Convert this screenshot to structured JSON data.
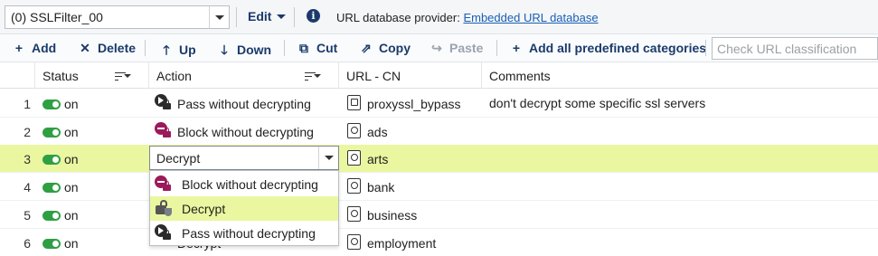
{
  "filter": {
    "selected": "(0) SSLFilter_00"
  },
  "menu": {
    "edit_label": "Edit"
  },
  "provider": {
    "label": "URL database provider:",
    "link": "Embedded URL database"
  },
  "toolbar": {
    "add": "Add",
    "delete": "Delete",
    "up": "Up",
    "down": "Down",
    "cut": "Cut",
    "copy": "Copy",
    "paste": "Paste",
    "add_all": "Add all predefined categories",
    "search_placeholder": "Check URL classification"
  },
  "columns": {
    "status": "Status",
    "action": "Action",
    "url": "URL - CN",
    "comments": "Comments"
  },
  "rows": [
    {
      "num": "1",
      "status": "on",
      "action": "Pass without decrypting",
      "action_icon": "pass-lock-icon",
      "url": "proxyssl_bypass",
      "url_icon": "user-url-group-icon",
      "comment": "don't decrypt some specific ssl servers"
    },
    {
      "num": "2",
      "status": "on",
      "action": "Block without decrypting",
      "action_icon": "block-lock-icon",
      "url": "ads",
      "url_icon": "url-category-icon",
      "comment": ""
    },
    {
      "num": "3",
      "status": "on",
      "action": "Decrypt",
      "action_icon": "decrypt-icon",
      "url": "arts",
      "url_icon": "url-category-icon",
      "comment": ""
    },
    {
      "num": "4",
      "status": "on",
      "action": "",
      "url": "bank",
      "url_icon": "url-category-icon",
      "comment": ""
    },
    {
      "num": "5",
      "status": "on",
      "action": "",
      "url": "business",
      "url_icon": "url-category-icon",
      "comment": ""
    },
    {
      "num": "6",
      "status": "on",
      "action": "Decrypt",
      "url": "employment",
      "url_icon": "url-category-icon",
      "comment": ""
    }
  ],
  "editor": {
    "value": "Decrypt"
  },
  "dropdown": {
    "options": [
      {
        "label": "Block without decrypting",
        "icon": "block-lock-icon"
      },
      {
        "label": "Decrypt",
        "icon": "decrypt-icon",
        "highlighted": true
      },
      {
        "label": "Pass without decrypting",
        "icon": "pass-lock-icon"
      }
    ]
  },
  "colors": {
    "selected_row": "#eaf7a0",
    "toggle_on": "#2ea043",
    "accent": "#1a3a6b",
    "block": "#9b1b5a"
  }
}
